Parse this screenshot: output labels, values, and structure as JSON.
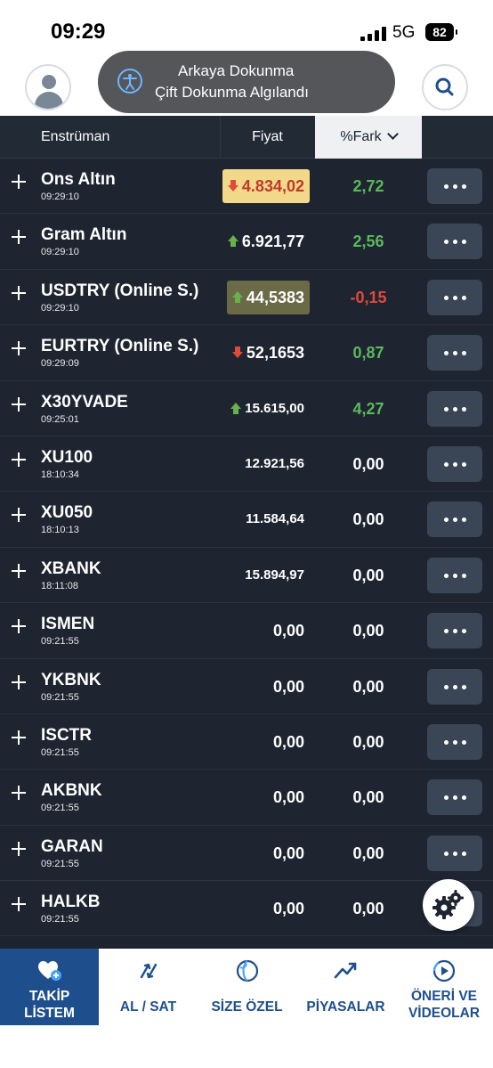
{
  "status_bar": {
    "time": "09:29",
    "network": "5G",
    "battery": "82"
  },
  "toast": {
    "line1": "Arkaya Dokunma",
    "line2": "Çift Dokunma Algılandı"
  },
  "table": {
    "headers": {
      "instrument": "Enstrüman",
      "price": "Fiyat",
      "diff": "%Fark"
    },
    "rows": [
      {
        "name": "Ons Altın",
        "time": "09:29:10",
        "price": "4.834,02",
        "diff": "2,72",
        "trend": "down",
        "highlight": "yellow",
        "size": "big"
      },
      {
        "name": "Gram Altın",
        "time": "09:29:10",
        "price": "6.921,77",
        "diff": "2,56",
        "trend": "up",
        "highlight": "none",
        "size": "big"
      },
      {
        "name": "USDTRY (Online S.)",
        "time": "09:29:10",
        "price": "44,5383",
        "diff": "-0,15",
        "trend": "up",
        "highlight": "olive",
        "size": "big"
      },
      {
        "name": "EURTRY (Online S.)",
        "time": "09:29:09",
        "price": "52,1653",
        "diff": "0,87",
        "trend": "down",
        "highlight": "none",
        "size": "big"
      },
      {
        "name": "X30YVADE",
        "time": "09:25:01",
        "price": "15.615,00",
        "diff": "4,27",
        "trend": "up",
        "highlight": "none",
        "size": "small"
      },
      {
        "name": "XU100",
        "time": "18:10:34",
        "price": "12.921,56",
        "diff": "0,00",
        "trend": "none",
        "highlight": "none",
        "size": "small"
      },
      {
        "name": "XU050",
        "time": "18:10:13",
        "price": "11.584,64",
        "diff": "0,00",
        "trend": "none",
        "highlight": "none",
        "size": "small"
      },
      {
        "name": "XBANK",
        "time": "18:11:08",
        "price": "15.894,97",
        "diff": "0,00",
        "trend": "none",
        "highlight": "none",
        "size": "small"
      },
      {
        "name": "ISMEN",
        "time": "09:21:55",
        "price": "0,00",
        "diff": "0,00",
        "trend": "none",
        "highlight": "none",
        "size": "big"
      },
      {
        "name": "YKBNK",
        "time": "09:21:55",
        "price": "0,00",
        "diff": "0,00",
        "trend": "none",
        "highlight": "none",
        "size": "big"
      },
      {
        "name": "ISCTR",
        "time": "09:21:55",
        "price": "0,00",
        "diff": "0,00",
        "trend": "none",
        "highlight": "none",
        "size": "big"
      },
      {
        "name": "AKBNK",
        "time": "09:21:55",
        "price": "0,00",
        "diff": "0,00",
        "trend": "none",
        "highlight": "none",
        "size": "big"
      },
      {
        "name": "GARAN",
        "time": "09:21:55",
        "price": "0,00",
        "diff": "0,00",
        "trend": "none",
        "highlight": "none",
        "size": "big"
      },
      {
        "name": "HALKB",
        "time": "09:21:55",
        "price": "0,00",
        "diff": "0,00",
        "trend": "none",
        "highlight": "none",
        "size": "big"
      }
    ]
  },
  "nav": {
    "items": [
      {
        "line1": "TAKİP",
        "line2": "LİSTEM",
        "icon": "heart-plus-icon",
        "active": true
      },
      {
        "line1": "AL / SAT",
        "line2": "",
        "icon": "swap-arrows-icon",
        "active": false
      },
      {
        "line1": "SİZE ÖZEL",
        "line2": "",
        "icon": "globe-icon",
        "active": false
      },
      {
        "line1": "PİYASALAR",
        "line2": "",
        "icon": "trend-up-icon",
        "active": false
      },
      {
        "line1": "ÖNERİ VE",
        "line2": "VİDEOLAR",
        "icon": "play-circle-icon",
        "active": false
      }
    ]
  },
  "colors": {
    "positive": "#5cb85c",
    "negative": "#e04a3a",
    "neutral": "#ffffff",
    "brand": "#1e4f8c",
    "row_bg": "#1e2531"
  }
}
